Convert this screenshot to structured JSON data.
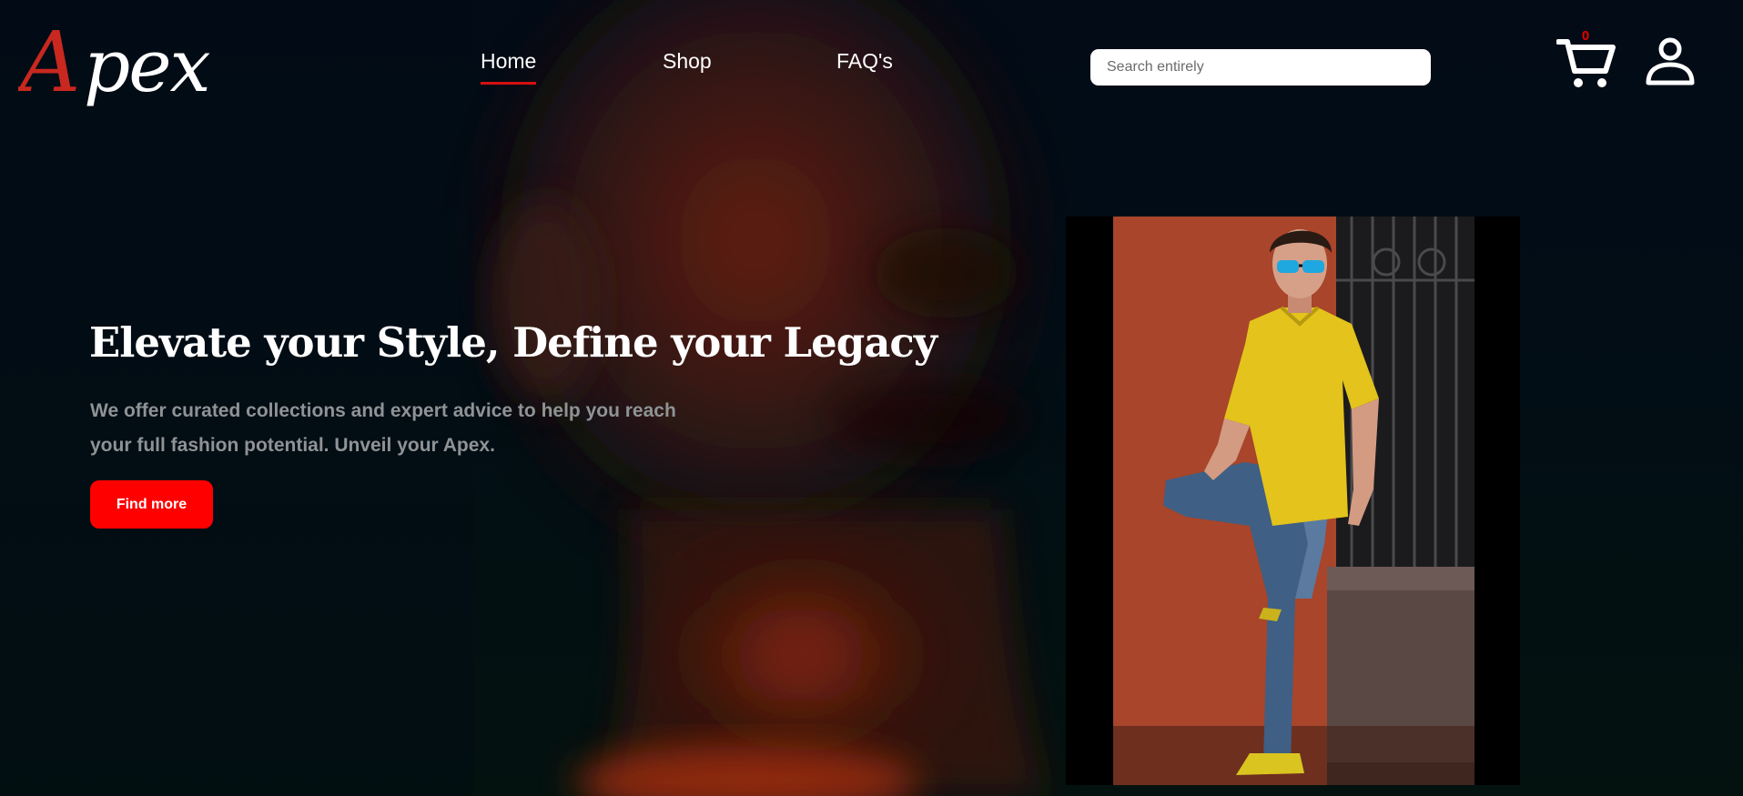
{
  "brand": {
    "logo_text": "Apex",
    "colors": {
      "logo_red": "#c8281f",
      "logo_white": "#ffffff"
    }
  },
  "nav": {
    "items": [
      {
        "label": "Home",
        "active": true
      },
      {
        "label": "Shop",
        "active": false
      },
      {
        "label": "FAQ's",
        "active": false
      }
    ]
  },
  "search": {
    "placeholder": "Search entirely",
    "value": ""
  },
  "cart": {
    "icon": "cart-icon",
    "count": "0"
  },
  "account": {
    "icon": "user-icon"
  },
  "hero": {
    "headline": "Elevate your Style, Define your Legacy",
    "subtext": "We offer curated collections and expert advice to help you reach your full fashion potential. Unveil your Apex.",
    "cta_label": "Find more"
  },
  "colors": {
    "accent": "#ff0000",
    "active_underline": "#d41010",
    "background": "#020a14",
    "subtext": "#8f9396"
  }
}
